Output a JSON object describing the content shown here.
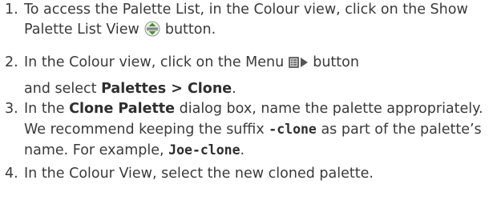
{
  "steps": [
    {
      "number": "1.",
      "text_a": "To access the Palette List, in the Colour view, click on the Show Palette List View",
      "text_b": "button.",
      "icon": "show-palette-list-view-icon"
    },
    {
      "number": "2.",
      "text_a": "In the Colour view, click on the Menu",
      "text_b": "button",
      "text_c": "and select",
      "bold": "Palettes > Clone",
      "text_d": ".",
      "icon": "menu-icon"
    },
    {
      "number": "3.",
      "text_a": "In the",
      "bold": "Clone Palette",
      "text_b": "dialog box, name the palette appropriately. We recommend keeping the suffix",
      "code_a": "-clone",
      "text_c": "as part of the palette’s name. For example,",
      "code_b": "Joe-clone",
      "text_d": "."
    },
    {
      "number": "4.",
      "text_a": "In the Colour View, select the new cloned palette."
    }
  ],
  "colors": {
    "text": "#3a3a3a",
    "icon_green": "#4a8a3a",
    "icon_dark": "#5a5a5a"
  }
}
